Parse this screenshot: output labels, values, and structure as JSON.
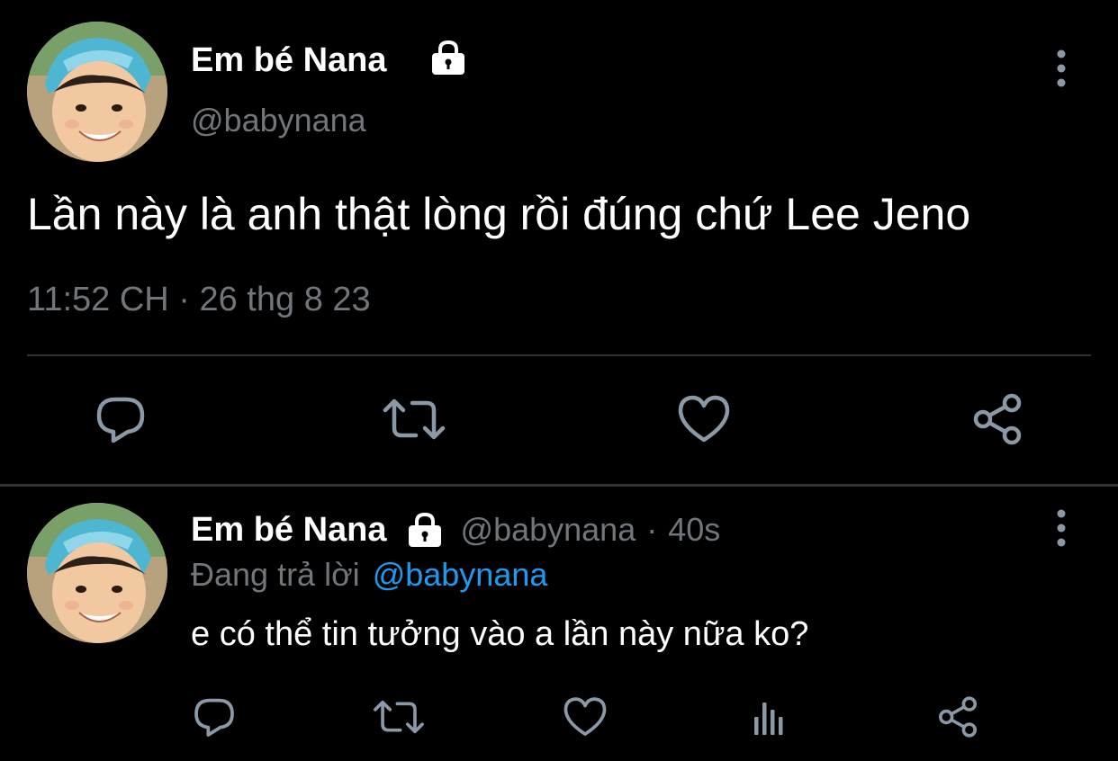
{
  "colors": {
    "background": "#000000",
    "text_primary": "#ffffff",
    "text_secondary": "#71767b",
    "icon": "#8b98a5",
    "divider": "#2f3336",
    "link": "#1d9bf0"
  },
  "main_tweet": {
    "author": {
      "display_name": "Em bé Nana",
      "handle": "@babynana",
      "protected_icon": "lock-icon",
      "avatar_icon": "avatar-photo"
    },
    "text": "Lần này là anh thật lòng rồi đúng chứ Lee Jeno",
    "timestamp": "11:52 CH · 26 thg 8 23",
    "more_icon": "more-vertical-icon",
    "actions": [
      {
        "name": "reply",
        "icon": "reply-icon"
      },
      {
        "name": "retweet",
        "icon": "retweet-icon"
      },
      {
        "name": "like",
        "icon": "heart-icon"
      },
      {
        "name": "share",
        "icon": "share-icon"
      }
    ]
  },
  "reply_tweet": {
    "author": {
      "display_name": "Em bé Nana",
      "handle": "@babynana",
      "protected_icon": "lock-icon",
      "avatar_icon": "avatar-photo"
    },
    "separator": "·",
    "time": "40s",
    "replying_to_label": "Đang trả lời",
    "replying_to_handle": "@babynana",
    "text": "e có thể tin tưởng vào a lần này nữa ko?",
    "more_icon": "more-vertical-icon",
    "actions": [
      {
        "name": "reply",
        "icon": "reply-icon"
      },
      {
        "name": "retweet",
        "icon": "retweet-icon"
      },
      {
        "name": "like",
        "icon": "heart-icon"
      },
      {
        "name": "views",
        "icon": "views-icon"
      },
      {
        "name": "share",
        "icon": "share-icon"
      }
    ]
  }
}
